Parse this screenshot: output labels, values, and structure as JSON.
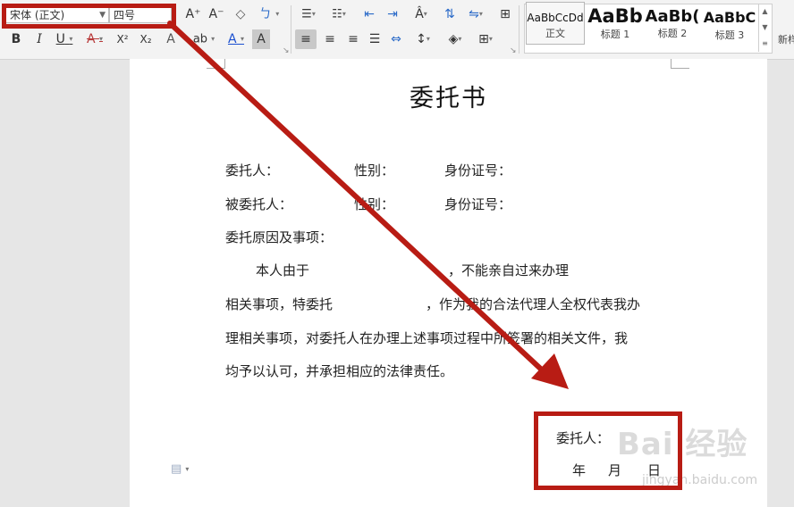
{
  "ribbon": {
    "font_name": "宋体 (正文)",
    "font_size": "四号",
    "buttons": {
      "grow_font": "A⁺",
      "shrink_font": "A⁻",
      "clear_format": "◇",
      "phonetic": "ㄅ",
      "bold": "B",
      "italic": "I",
      "underline": "U",
      "strikethrough": "A",
      "superscript": "X²",
      "subscript": "X₂",
      "text_effect": "A",
      "highlight": "ab",
      "font_color": "A",
      "char_shading": "A"
    },
    "styles": [
      {
        "sample": "AaBbCcDd",
        "name": "正文"
      },
      {
        "sample": "AaBb",
        "name": "标题 1"
      },
      {
        "sample": "AaBb(",
        "name": "标题 2"
      },
      {
        "sample": "AaBbC",
        "name": "标题 3"
      }
    ],
    "new_style": "新样"
  },
  "document": {
    "title": "委托书",
    "line1": [
      "委托人：",
      "性别：",
      "身份证号："
    ],
    "line2": [
      "被委托人：",
      "性别：",
      "身份证号："
    ],
    "line3": "委托原因及事项：",
    "para_start": "本人由于",
    "para_comma": "，不能亲自过来办理",
    "line5a": "相关事项，特委托",
    "line5b": "，作为我的合法代理人全权代表我办",
    "line6": "理相关事项，对委托人在办理上述事项过程中所签署的相关文件，我",
    "line7": "均予以认可，并承担相应的法律责任。",
    "sign_label": "委托人：",
    "date": [
      "年",
      "月",
      "日"
    ]
  },
  "annotation": {
    "color": "#b81c14"
  },
  "watermark": {
    "text": "Bai 经验",
    "sub": "jingyan.baidu.com"
  }
}
